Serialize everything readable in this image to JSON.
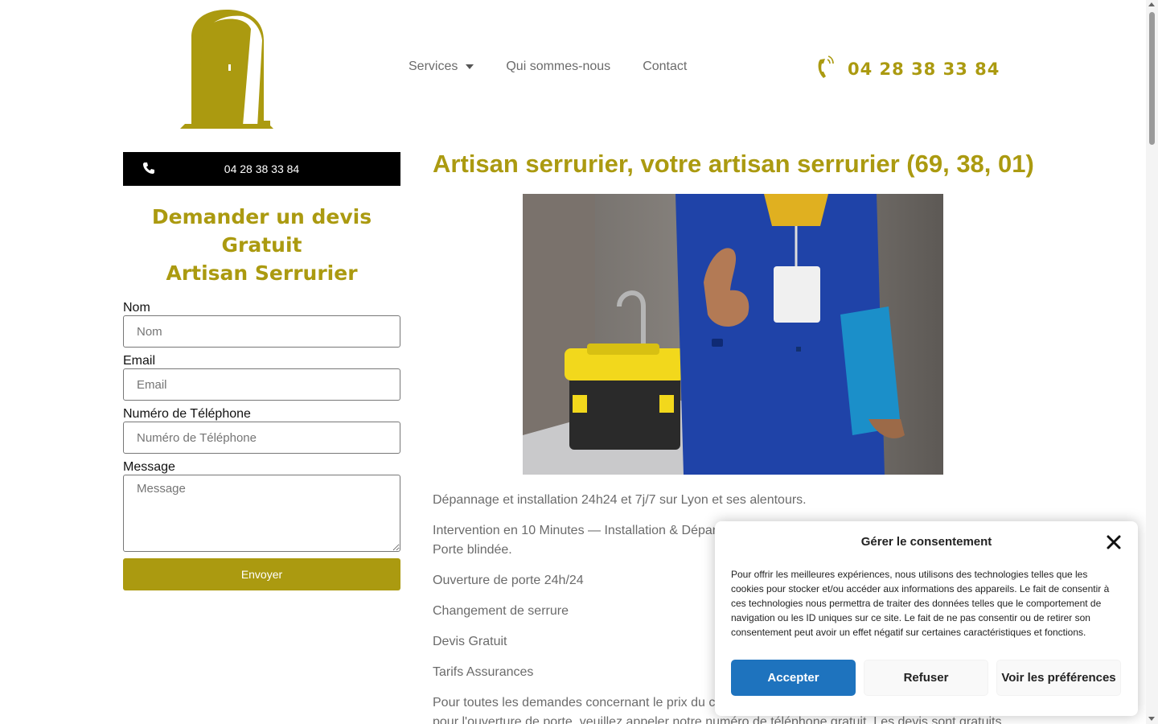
{
  "colors": {
    "accent": "#ab9a10",
    "accept_button": "#1e73be",
    "call_button": "#000000"
  },
  "header": {
    "logo_icon": "door-logo-icon",
    "nav": [
      {
        "label": "Services",
        "has_dropdown": true
      },
      {
        "label": "Qui sommes-nous",
        "has_dropdown": false
      },
      {
        "label": "Contact",
        "has_dropdown": false
      }
    ],
    "phone": "04 28 38 33 84",
    "phone_icon": "phone-ringing-icon"
  },
  "sidebar": {
    "call_button_label": "04 28 38 33 84",
    "quote_title_line1": "Demander un devis",
    "quote_title_line2": "Gratuit",
    "quote_title_line3": "Artisan Serrurier",
    "form": {
      "name_label": "Nom",
      "name_placeholder": "Nom",
      "email_label": "Email",
      "email_placeholder": "Email",
      "phone_label": "Numéro de Téléphone",
      "phone_placeholder": "Numéro de Téléphone",
      "message_label": "Message",
      "message_placeholder": "Message",
      "submit_label": "Envoyer"
    }
  },
  "main": {
    "title": "Artisan serrurier, votre artisan serrurier (69, 38, 01)",
    "paragraphs": [
      "Dépannage et installation 24h24 et 7j/7 sur Lyon et ses alentours.",
      "Intervention en 10 Minutes — Installation & Dépan",
      "Porte blindée.",
      "Ouverture de porte 24h/24",
      "Changement de serrure",
      "Devis Gratuit",
      "Tarifs Assurances",
      "Pour toutes les demandes concernant le prix du c",
      "pour l'ouverture de porte, veuillez appeler notre numéro de téléphone gratuit. Les devis sont gratuits."
    ]
  },
  "consent": {
    "title": "Gérer le consentement",
    "text": "Pour offrir les meilleures expériences, nous utilisons des technologies telles que les cookies pour stocker et/ou accéder aux informations des appareils. Le fait de consentir à ces technologies nous permettra de traiter des données telles que le comportement de navigation ou les ID uniques sur ce site. Le fait de ne pas consentir ou de retirer son consentement peut avoir un effet négatif sur certaines caractéristiques et fonctions.",
    "accept_label": "Accepter",
    "refuse_label": "Refuser",
    "prefs_label": "Voir les préférences"
  }
}
